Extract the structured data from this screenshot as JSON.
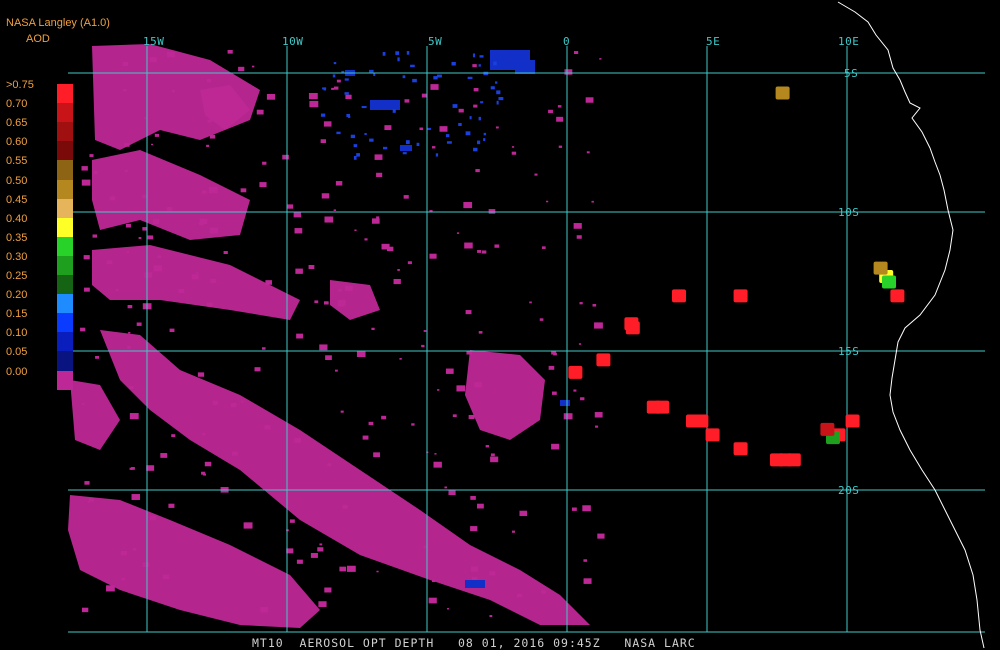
{
  "header": {
    "source": "NASA Langley (A1.0)",
    "variable": "AOD"
  },
  "legend": {
    "labels": [
      ">0.75",
      "0.70",
      "0.65",
      "0.60",
      "0.55",
      "0.50",
      "0.45",
      "0.40",
      "0.35",
      "0.30",
      "0.25",
      "0.20",
      "0.15",
      "0.10",
      "0.05",
      "0.00"
    ],
    "colors": [
      "#ff1e28",
      "#c81418",
      "#a01010",
      "#7a0a0a",
      "#8c6414",
      "#b4881e",
      "#e6b45a",
      "#ffff28",
      "#28d228",
      "#1ea01e",
      "#146414",
      "#1e8cff",
      "#0a3cff",
      "#0a1ebe",
      "#0a1480",
      "#be2896"
    ]
  },
  "longitude_labels": [
    "15W",
    "10W",
    "5W",
    "0",
    "5E",
    "10E"
  ],
  "latitude_labels": [
    "5S",
    "10S",
    "15S",
    "20S"
  ],
  "footer": "MT10  AEROSOL OPT DEPTH   08 01, 2016 09:45Z   NASA LARC",
  "map": {
    "lon_range": [
      -18,
      11
    ],
    "lat_range": [
      -4,
      -25
    ],
    "grid_color": "#40c8c8",
    "coast_color": "#ffffff",
    "aerosol_marks": [
      {
        "lon": 2.3,
        "lat": -14.0,
        "aod": 0.8
      },
      {
        "lon": 2.35,
        "lat": -14.15,
        "aod": 0.8
      },
      {
        "lon": 4.0,
        "lat": -13.0,
        "aod": 0.8
      },
      {
        "lon": 6.2,
        "lat": -13.0,
        "aod": 0.8
      },
      {
        "lon": 1.3,
        "lat": -15.3,
        "aod": 0.8
      },
      {
        "lon": 0.3,
        "lat": -15.75,
        "aod": 0.8
      },
      {
        "lon": 3.1,
        "lat": -17.0,
        "aod": 0.8
      },
      {
        "lon": 3.4,
        "lat": -17.0,
        "aod": 0.8
      },
      {
        "lon": 4.5,
        "lat": -17.5,
        "aod": 0.8
      },
      {
        "lon": 4.8,
        "lat": -17.5,
        "aod": 0.8
      },
      {
        "lon": 5.2,
        "lat": -18.0,
        "aod": 0.8
      },
      {
        "lon": 6.2,
        "lat": -18.5,
        "aod": 0.8
      },
      {
        "lon": 7.5,
        "lat": -18.9,
        "aod": 0.8
      },
      {
        "lon": 7.8,
        "lat": -18.9,
        "aod": 0.8
      },
      {
        "lon": 8.1,
        "lat": -18.9,
        "aod": 0.8
      },
      {
        "lon": 9.7,
        "lat": -18.0,
        "aod": 0.8
      },
      {
        "lon": 10.2,
        "lat": -17.5,
        "aod": 0.8
      },
      {
        "lon": 11.8,
        "lat": -13.0,
        "aod": 0.8
      },
      {
        "lon": 11.4,
        "lat": -12.3,
        "aod": 0.42
      },
      {
        "lon": 11.2,
        "lat": -12.0,
        "aod": 0.5
      },
      {
        "lon": 11.5,
        "lat": -12.5,
        "aod": 0.35
      },
      {
        "lon": 7.7,
        "lat": -5.7,
        "aod": 0.52
      },
      {
        "lon": 9.5,
        "lat": -18.1,
        "aod": 0.3
      },
      {
        "lon": 9.3,
        "lat": -17.8,
        "aod": 0.7
      }
    ]
  }
}
